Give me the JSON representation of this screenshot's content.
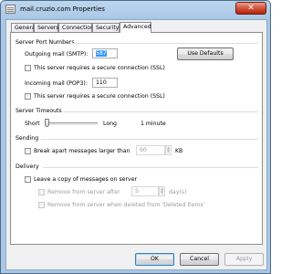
{
  "window": {
    "title": "mail.cruzio.com Properties",
    "close_glyph": "✕",
    "icon": "properties-icon"
  },
  "tabs": [
    {
      "label": "General",
      "active": false
    },
    {
      "label": "Servers",
      "active": false
    },
    {
      "label": "Connection",
      "active": false
    },
    {
      "label": "Security",
      "active": false
    },
    {
      "label": "Advanced",
      "active": true
    }
  ],
  "server_ports": {
    "heading": "Server Port Numbers",
    "outgoing_label": "Outgoing mail (SMTP):",
    "outgoing_value": "587",
    "use_defaults_label": "Use Defaults",
    "outgoing_ssl_label": "This server requires a secure connection (SSL)",
    "outgoing_ssl_checked": false,
    "incoming_label": "Incoming mail (POP3):",
    "incoming_value": "110",
    "incoming_ssl_label": "This server requires a secure connection (SSL)",
    "incoming_ssl_checked": false
  },
  "timeouts": {
    "heading": "Server Timeouts",
    "short_label": "Short",
    "long_label": "Long",
    "value_label": "1 minute",
    "level": 0.0
  },
  "sending": {
    "heading": "Sending",
    "break_apart_label": "Break apart messages larger than",
    "break_apart_checked": false,
    "size_value": "60",
    "size_unit": "KB"
  },
  "delivery": {
    "heading": "Delivery",
    "leave_copy_label": "Leave a copy of messages on server",
    "leave_copy_checked": false,
    "remove_after_label": "Remove from server after",
    "remove_after_value": "5",
    "remove_after_unit": "day(s)",
    "remove_deleted_label": "Remove from server when deleted from 'Deleted Items'"
  },
  "buttons": {
    "ok": "OK",
    "cancel": "Cancel",
    "apply": "Apply"
  }
}
